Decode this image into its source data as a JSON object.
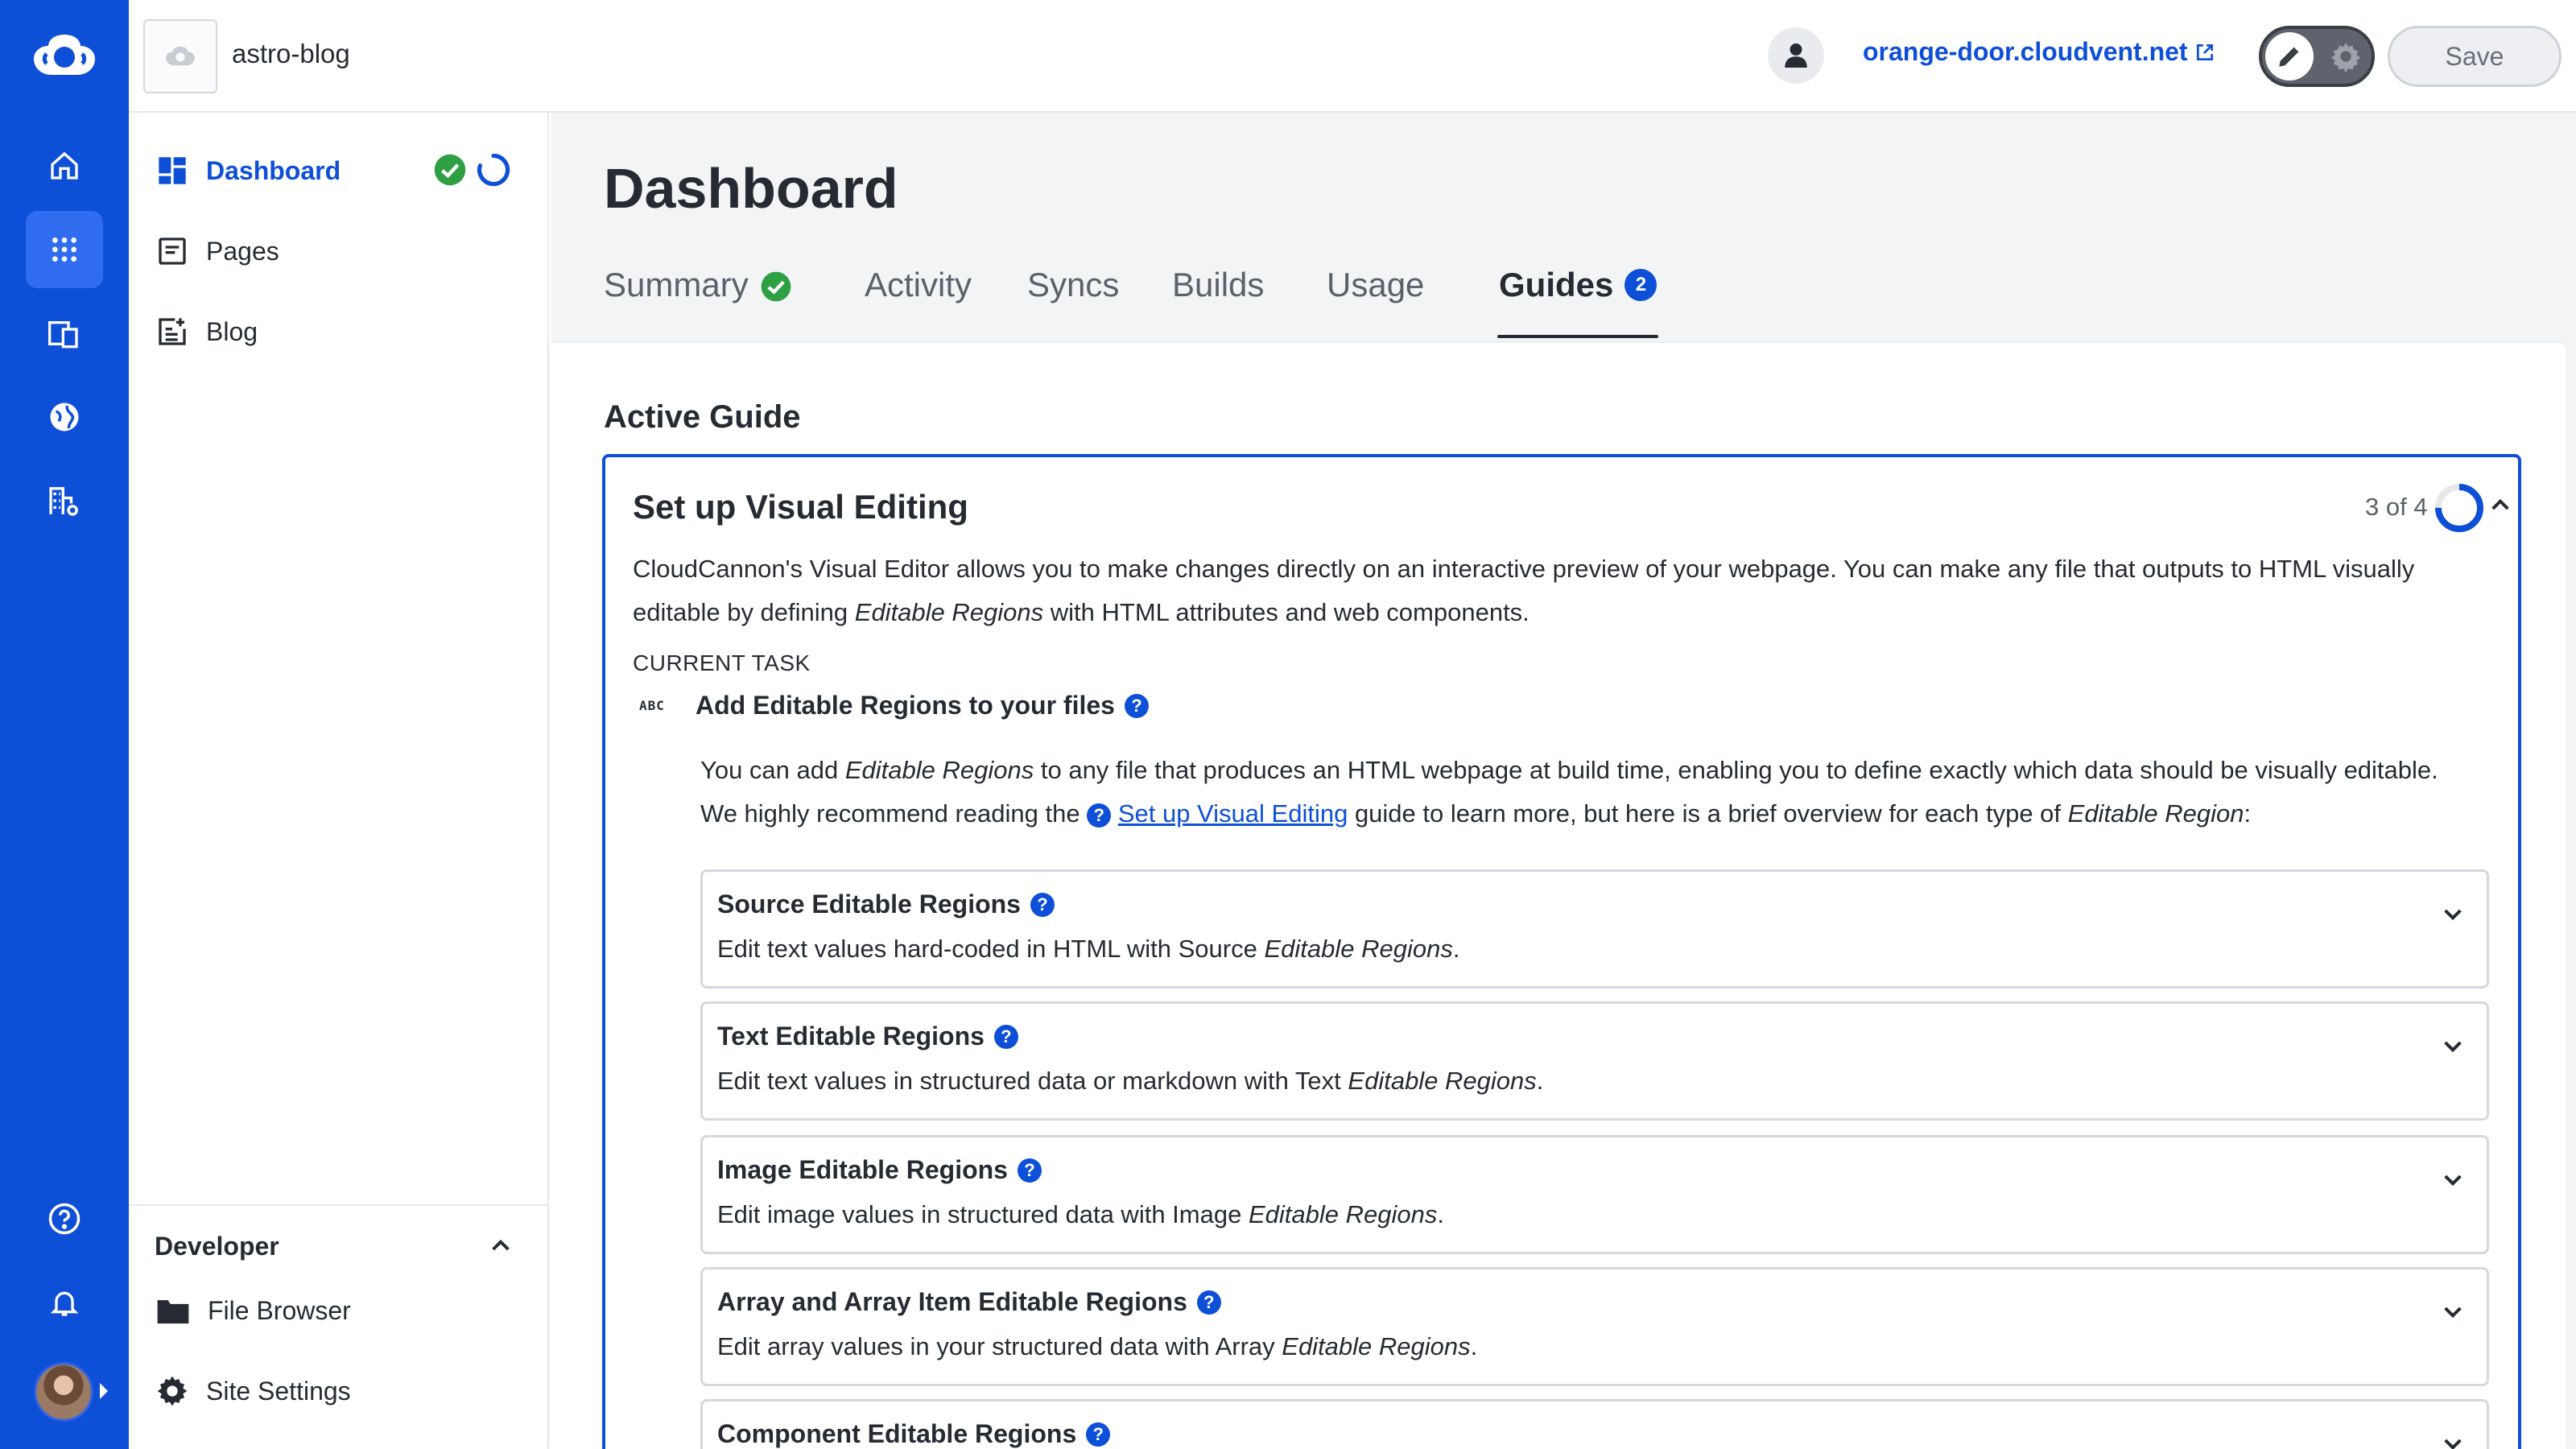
{
  "app": {
    "site_name": "astro-blog",
    "site_url": "orange-door.cloudvent.net",
    "save_label": "Save"
  },
  "colors": {
    "brand": "#0e4fd8",
    "rail_active": "#2f6cf0",
    "success": "#2ea043",
    "text": "#262b33",
    "muted": "#5b616b"
  },
  "rail": {
    "items": [
      {
        "icon": "home-icon"
      },
      {
        "icon": "grid-icon",
        "active": true
      },
      {
        "icon": "devices-icon"
      },
      {
        "icon": "globe-icon"
      },
      {
        "icon": "buildings-settings-icon"
      },
      {
        "icon": "help-icon"
      },
      {
        "icon": "bell-icon"
      }
    ]
  },
  "sidebar": {
    "items": [
      {
        "label": "Dashboard",
        "icon": "dashboard-icon",
        "active": true
      },
      {
        "label": "Pages",
        "icon": "pages-icon"
      },
      {
        "label": "Blog",
        "icon": "blog-icon"
      }
    ],
    "developer": {
      "title": "Developer",
      "items": [
        {
          "label": "File Browser",
          "icon": "folder-icon"
        },
        {
          "label": "Site Settings",
          "icon": "gear-icon"
        }
      ]
    }
  },
  "main": {
    "title": "Dashboard",
    "tabs": [
      {
        "label": "Summary"
      },
      {
        "label": "Activity"
      },
      {
        "label": "Syncs"
      },
      {
        "label": "Builds"
      },
      {
        "label": "Usage"
      },
      {
        "label": "Guides",
        "badge": "2",
        "active": true
      }
    ],
    "section_heading": "Active Guide"
  },
  "guide": {
    "title": "Set up Visual Editing",
    "progress_text": "3 of 4",
    "progress_fraction": 0.75,
    "desc_part1": "CloudCannon's Visual Editor allows you to make changes directly on an interactive preview of your webpage. You can make any file that outputs to HTML visually editable by defining ",
    "desc_em": "Editable Regions",
    "desc_part2": " with HTML attributes and web components.",
    "current_task_label": "CURRENT TASK",
    "task_icon_text": "ABC",
    "task_title": "Add Editable Regions to your files",
    "task_desc_part1": "You can add ",
    "task_desc_em1": "Editable Regions",
    "task_desc_part2": " to any file that produces an HTML webpage at build time, enabling you to define exactly which data should be visually editable. We highly recommend reading the ",
    "task_desc_link": "Set up Visual Editing",
    "task_desc_part3": " guide to learn more, but here is a brief overview for each type of ",
    "task_desc_em2": "Editable Region",
    "task_desc_part4": ":",
    "help_glyph": "?",
    "regions": [
      {
        "title": "Source Editable Regions",
        "desc": "Edit text values hard-coded in HTML with Source ",
        "desc_em": "Editable Regions",
        "desc_end": "."
      },
      {
        "title": "Text Editable Regions",
        "desc": "Edit text values in structured data or markdown with Text ",
        "desc_em": "Editable Regions",
        "desc_end": "."
      },
      {
        "title": "Image Editable Regions",
        "desc": "Edit image values in structured data with Image ",
        "desc_em": "Editable Regions",
        "desc_end": "."
      },
      {
        "title": "Array and Array Item Editable Regions",
        "desc": "Edit array values in your structured data with Array ",
        "desc_em": "Editable Regions",
        "desc_end": "."
      },
      {
        "title": "Component Editable Regions",
        "desc": "",
        "desc_em": "",
        "desc_end": ""
      }
    ]
  }
}
